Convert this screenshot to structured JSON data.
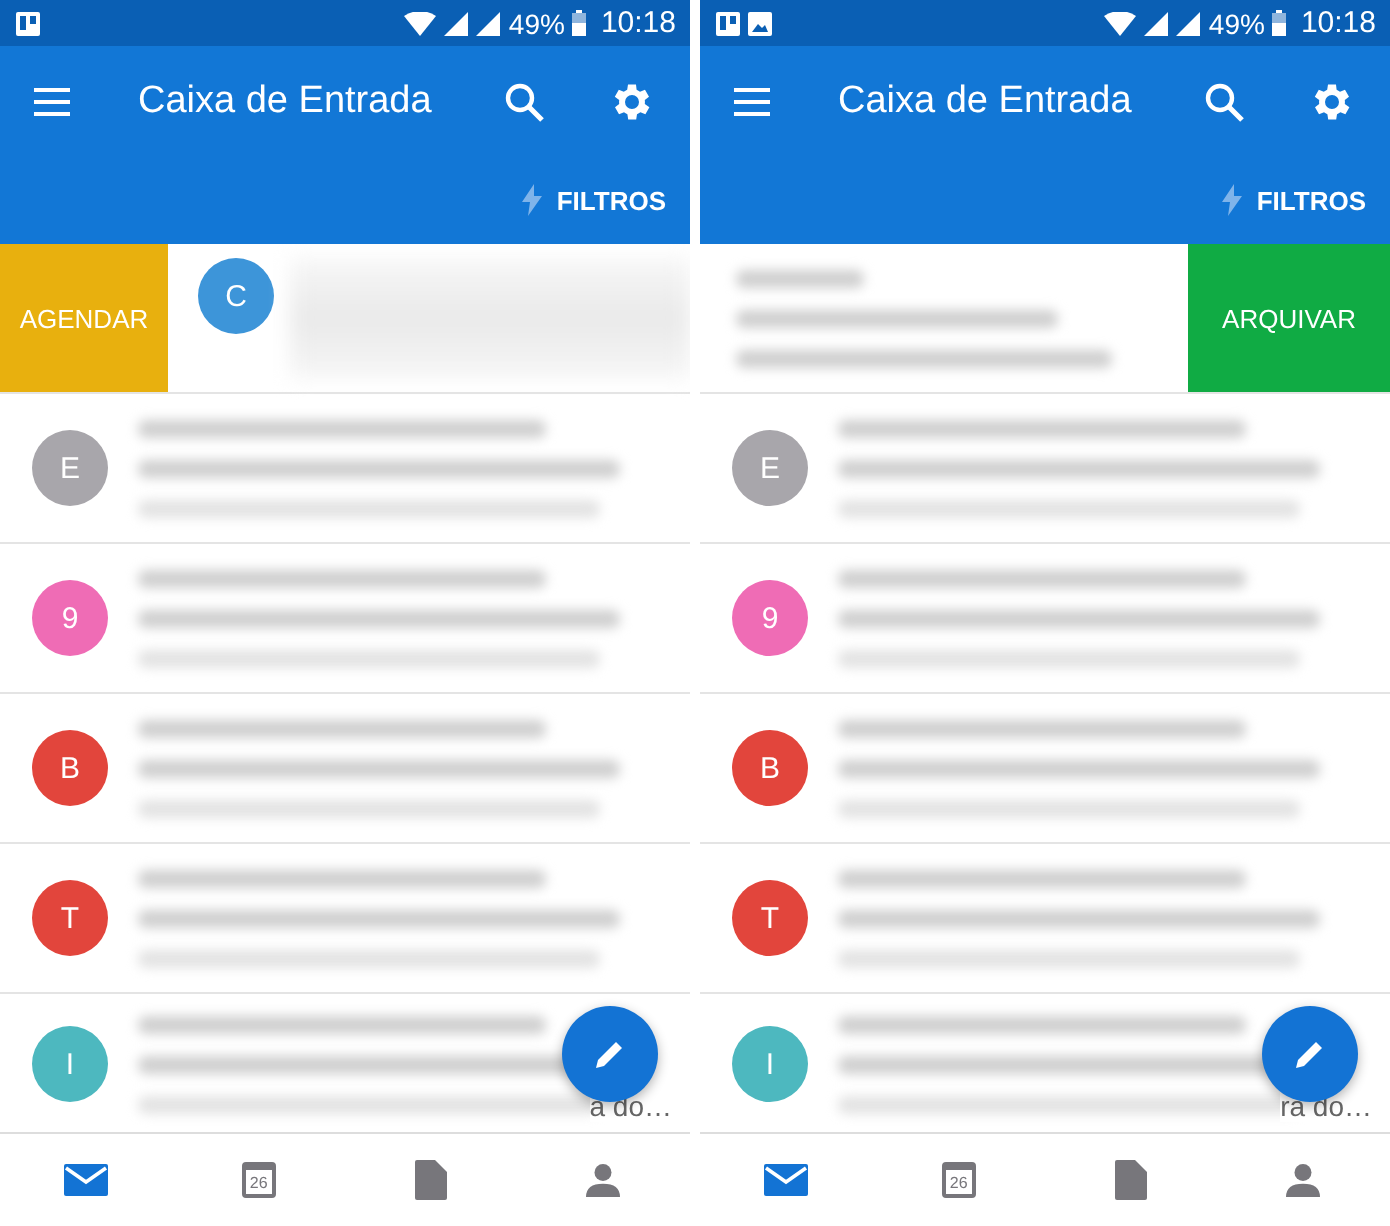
{
  "screens": [
    {
      "status_bar": {
        "notification_icons": [
          {
            "kind": "board"
          }
        ],
        "battery": "49%",
        "time": "10:18"
      },
      "toolbar": {
        "title": "Caixa de Entrada",
        "filter": "FILTROS"
      },
      "swipe": {
        "kind": "schedule",
        "label": "AGENDAR",
        "color": "#e8b00e",
        "avatar": {
          "initial": "C",
          "color": "#3d95d9"
        }
      },
      "rows": [
        {
          "initial": "E",
          "color": "#a8a6ab"
        },
        {
          "initial": "9",
          "color": "#ef6cb5"
        },
        {
          "initial": "B",
          "color": "#e2453c"
        },
        {
          "initial": "T",
          "color": "#e2453c"
        },
        {
          "initial": "I",
          "color": "#4db8bf",
          "snippet_end": "a do…"
        }
      ],
      "nav": [
        {
          "kind": "mail",
          "selected": true
        },
        {
          "kind": "calendar",
          "label": "26",
          "selected": false
        },
        {
          "kind": "file",
          "selected": false
        },
        {
          "kind": "person",
          "selected": false
        }
      ]
    },
    {
      "status_bar": {
        "notification_icons": [
          {
            "kind": "board"
          },
          {
            "kind": "image"
          }
        ],
        "battery": "49%",
        "time": "10:18"
      },
      "toolbar": {
        "title": "Caixa de Entrada",
        "filter": "FILTROS"
      },
      "swipe": {
        "kind": "archive",
        "label": "ARQUIVAR",
        "color": "#10ab44"
      },
      "rows": [
        {
          "initial": "E",
          "color": "#a8a6ab"
        },
        {
          "initial": "9",
          "color": "#ef6cb5"
        },
        {
          "initial": "B",
          "color": "#e2453c"
        },
        {
          "initial": "T",
          "color": "#e2453c"
        },
        {
          "initial": "I",
          "color": "#4db8bf",
          "snippet_end": "ra do…"
        }
      ],
      "nav": [
        {
          "kind": "mail",
          "selected": true
        },
        {
          "kind": "calendar",
          "label": "26",
          "selected": false
        },
        {
          "kind": "file",
          "selected": false
        },
        {
          "kind": "person",
          "selected": false
        }
      ]
    }
  ]
}
